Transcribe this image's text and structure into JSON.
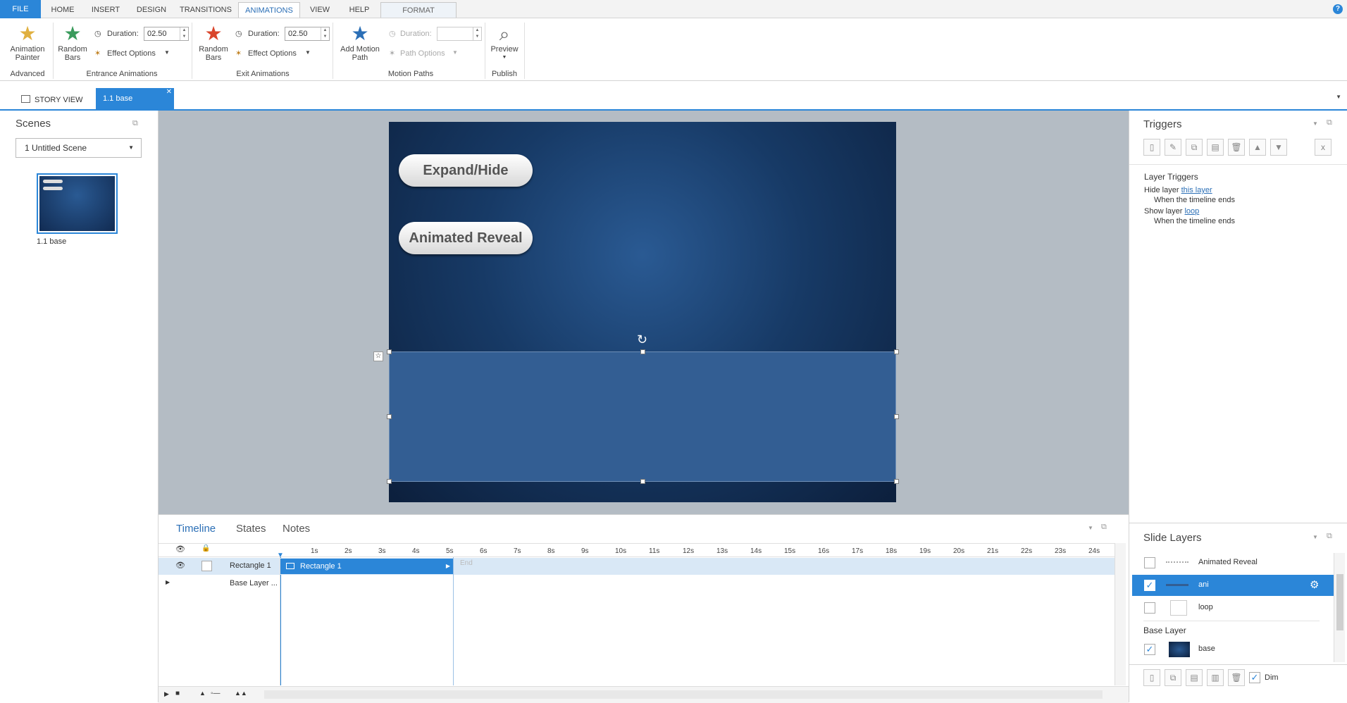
{
  "ribbon_tabs": {
    "file": "FILE",
    "home": "HOME",
    "insert": "INSERT",
    "design": "DESIGN",
    "transitions": "TRANSITIONS",
    "animations": "ANIMATIONS",
    "view": "VIEW",
    "help": "HELP",
    "format": "FORMAT"
  },
  "ribbon": {
    "animation_painter": "Animation Painter",
    "advanced_group": "Advanced",
    "entrance_random_bars": "Random Bars",
    "entrance_duration_label": "Duration:",
    "entrance_duration_value": "02.50",
    "entrance_effect_options": "Effect Options",
    "entrance_group": "Entrance Animations",
    "exit_random_bars": "Random Bars",
    "exit_duration_label": "Duration:",
    "exit_duration_value": "02.50",
    "exit_effect_options": "Effect Options",
    "exit_group": "Exit Animations",
    "add_motion_path": "Add Motion Path",
    "motion_duration_label": "Duration:",
    "path_options": "Path Options",
    "motion_group": "Motion Paths",
    "preview": "Preview",
    "publish_group": "Publish"
  },
  "doc_tabs": {
    "story_view": "STORY VIEW",
    "current": "1.1 base"
  },
  "scenes": {
    "title": "Scenes",
    "selector": "1 Untitled Scene",
    "thumb_label": "1.1 base"
  },
  "slide": {
    "button1": "Expand/Hide",
    "button2": "Animated Reveal"
  },
  "timeline": {
    "tabs": {
      "timeline": "Timeline",
      "states": "States",
      "notes": "Notes"
    },
    "ticks": [
      "1s",
      "2s",
      "3s",
      "4s",
      "5s",
      "6s",
      "7s",
      "8s",
      "9s",
      "10s",
      "11s",
      "12s",
      "13s",
      "14s",
      "15s",
      "16s",
      "17s",
      "18s",
      "19s",
      "20s",
      "21s",
      "22s",
      "23s",
      "24s"
    ],
    "row1_name": "Rectangle 1",
    "row1_bar": "Rectangle 1",
    "end_label": "End",
    "row2_name": "Base Layer ..."
  },
  "triggers": {
    "title": "Triggers",
    "section": "Layer Triggers",
    "t1_action": "Hide layer",
    "t1_link": "this layer",
    "t1_when": "When the timeline ends",
    "t2_action": "Show layer",
    "t2_link": "loop",
    "t2_when": "When the timeline ends"
  },
  "layers": {
    "title": "Slide Layers",
    "items": [
      "Animated Reveal",
      "ani",
      "loop"
    ],
    "base_header": "Base Layer",
    "base_name": "base",
    "dim": "Dim"
  },
  "colors": {
    "accent": "#2b86d8",
    "rect": "#335e93"
  }
}
